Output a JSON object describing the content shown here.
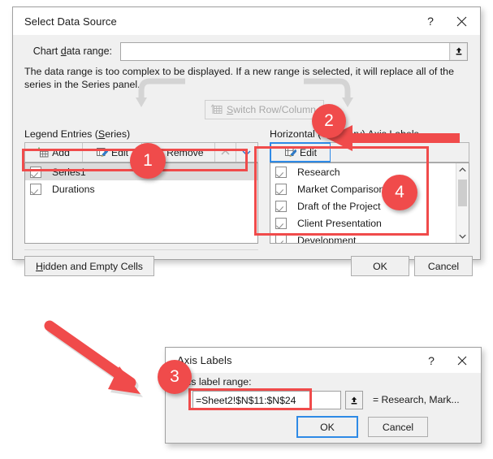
{
  "main_dialog": {
    "title": "Select Data Source",
    "help_icon": "question-mark-icon",
    "close_icon": "close-icon",
    "chart_data_range": {
      "label": "Chart data range:",
      "value": "",
      "placeholder": "",
      "picker_icon": "range-picker-icon"
    },
    "note": "The data range is too complex to be displayed. If a new range is selected, it will replace all of the series in the Series panel.",
    "switch_button": {
      "label": "Switch Row/Column",
      "icon": "switch-row-column-icon",
      "enabled": false
    },
    "legend_panel": {
      "group_label_pre": "Legend Entries (",
      "group_label_underline": "S",
      "group_label_post": "eries)",
      "toolbar": [
        {
          "label": "Add",
          "icon": "add-table-icon"
        },
        {
          "label": "Edit",
          "icon": "edit-pencil-icon"
        },
        {
          "label": "Remove",
          "icon": "remove-x-icon"
        },
        {
          "label": "⌃",
          "icon": "move-up-icon"
        },
        {
          "label": "⌄",
          "icon": "move-down-icon"
        }
      ],
      "items": [
        {
          "label": "Series1",
          "checked": true,
          "selected": true
        },
        {
          "label": "Durations",
          "checked": true,
          "selected": false
        }
      ]
    },
    "axis_panel": {
      "group_label": "Horizontal (Category) Axis Labels",
      "edit_button": {
        "label": "Edit",
        "icon": "edit-pencil-icon"
      },
      "items": [
        {
          "label": "Research",
          "checked": true
        },
        {
          "label": "Market Comparison",
          "checked": true
        },
        {
          "label": "Draft of the Project",
          "checked": true
        },
        {
          "label": "Client Presentation",
          "checked": true
        },
        {
          "label": "Development",
          "checked": true
        }
      ],
      "scroll_up_icon": "chevron-up-icon",
      "scroll_down_icon": "chevron-down-icon"
    },
    "footer": {
      "hidden_cells": "Hidden and Empty Cells",
      "ok": "OK",
      "cancel": "Cancel"
    }
  },
  "axis_dialog": {
    "title": "Axis Labels",
    "help_icon": "question-mark-icon",
    "close_icon": "close-icon",
    "field_label": "Axis label range:",
    "field_value": "=Sheet2!$N$11:$N$24",
    "picker_icon": "range-picker-icon",
    "result_preview": "= Research, Mark...",
    "ok": "OK",
    "cancel": "Cancel"
  },
  "annotations": {
    "accent_color": "#f04b4b",
    "badges": [
      {
        "number": "1"
      },
      {
        "number": "2"
      },
      {
        "number": "3"
      },
      {
        "number": "4"
      }
    ],
    "arrows": [
      {
        "name": "arrow-to-edit-button",
        "direction": "left"
      },
      {
        "name": "arrow-to-axis-label-range",
        "direction": "down-right"
      }
    ]
  }
}
